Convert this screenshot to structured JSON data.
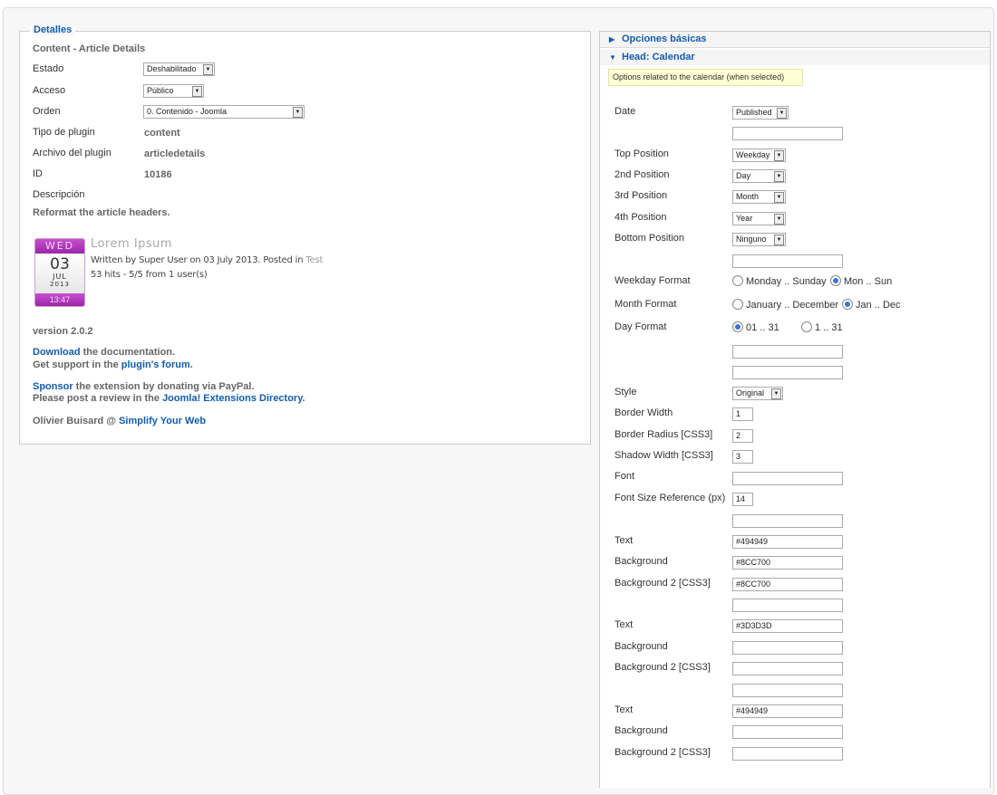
{
  "left": {
    "legend": "Detalles",
    "title": "Content - Article Details",
    "estado_label": "Estado",
    "estado_value": "Deshabilitado",
    "acceso_label": "Acceso",
    "acceso_value": "Público",
    "orden_label": "Orden",
    "orden_value": "0. Contenido - Joomla",
    "tipo_label": "Tipo de plugin",
    "tipo_value": "content",
    "archivo_label": "Archivo del plugin",
    "archivo_value": "articledetails",
    "id_label": "ID",
    "id_value": "10186",
    "descripcion_label": "Descripción",
    "descripcion_text": "Reformat the article headers.",
    "calendar": {
      "weekday": "WED",
      "day": "03",
      "month": "JUL",
      "year": "2013",
      "time": "13:47"
    },
    "article": {
      "title": "Lorem Ipsum",
      "meta": "Written by Super User on 03 July 2013. Posted in ",
      "category": "Test",
      "hits": "53 hits - 5/5 from 1 user(s)"
    },
    "version": "version 2.0.2",
    "download_link": "Download",
    "download_text": " the documentation.",
    "support_text": "Get support in the ",
    "forum_link": "plugin's forum",
    "period": ".",
    "sponsor_link": "Sponsor",
    "sponsor_text": " the extension by donating via PayPal.",
    "review_text": "Please post a review in the ",
    "jed_link": "Joomla! Extensions Directory",
    "author": "Olivier Buisard @ ",
    "syw_link": "Simplify Your Web"
  },
  "right": {
    "panel1": "Opciones básicas",
    "panel2": "Head: Calendar",
    "tooltip": "Options related to the calendar (when selected)",
    "date_label": "Date",
    "date_value": "Published",
    "top_label": "Top Position",
    "top_value": "Weekday",
    "p2_label": "2nd Position",
    "p2_value": "Day",
    "p3_label": "3rd Position",
    "p3_value": "Month",
    "p4_label": "4th Position",
    "p4_value": "Year",
    "bottom_label": "Bottom Position",
    "bottom_value": "Ninguno",
    "weekday_format_label": "Weekday Format",
    "weekday_opt1": "Monday .. Sunday",
    "weekday_opt2": "Mon .. Sun",
    "month_format_label": "Month Format",
    "month_opt1": "January .. December",
    "month_opt2": "Jan .. Dec",
    "day_format_label": "Day Format",
    "day_opt1": "01 .. 31",
    "day_opt2": "1 .. 31",
    "style_label": "Style",
    "style_value": "Original",
    "border_width_label": "Border Width",
    "border_width_value": "1",
    "border_radius_label": "Border Radius [CSS3]",
    "border_radius_value": "2",
    "shadow_label": "Shadow Width [CSS3]",
    "shadow_value": "3",
    "font_label": "Font",
    "font_value": "",
    "font_size_label": "Font Size Reference (px)",
    "font_size_value": "14",
    "text1_label": "Text",
    "text1_value": "#494949",
    "bg1_label": "Background",
    "bg1_value": "#8CC700",
    "bg2_1_label": "Background 2 [CSS3]",
    "bg2_1_value": "#8CC700",
    "text2_label": "Text",
    "text2_value": "#3D3D3D",
    "bg2_label": "Background",
    "bg2_value": "",
    "bg2_2_label": "Background 2 [CSS3]",
    "bg2_2_value": "",
    "text3_label": "Text",
    "text3_value": "#494949",
    "bg3_label": "Background",
    "bg3_value": "",
    "bg2_3_label": "Background 2 [CSS3]",
    "bg2_3_value": ""
  },
  "colors": {
    "link": "#135cae",
    "calendar": "#b03cbe",
    "tooltip_bg": "#ffffd5"
  }
}
